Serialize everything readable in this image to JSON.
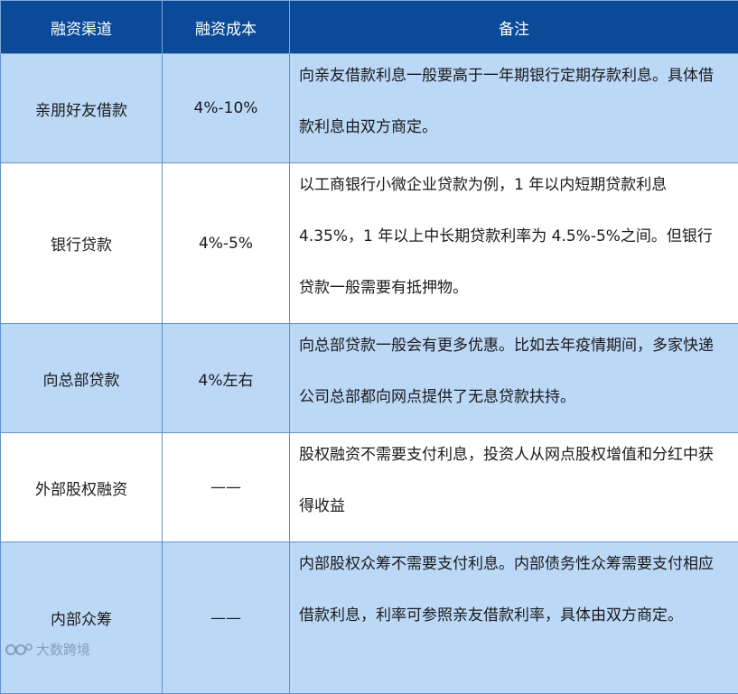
{
  "table": {
    "headers": [
      "融资渠道",
      "融资成本",
      "备注"
    ],
    "rows": [
      {
        "channel": "亲朋好友借款",
        "cost": "4%-10%",
        "note": "向亲友借款利息一般要高于一年期银行定期存款利息。具体借款利息由双方商定。"
      },
      {
        "channel": "银行贷款",
        "cost": "4%-5%",
        "note": "以工商银行小微企业贷款为例，1 年以内短期贷款利息 4.35%，1 年以上中长期贷款利率为 4.5%-5%之间。但银行贷款一般需要有抵押物。"
      },
      {
        "channel": "向总部贷款",
        "cost": "4%左右",
        "note": "向总部贷款一般会有更多优惠。比如去年疫情期间，多家快递公司总部都向网点提供了无息贷款扶持。"
      },
      {
        "channel": "外部股权融资",
        "cost": "——",
        "note": "股权融资不需要支付利息，投资人从网点股权增值和分红中获得收益"
      },
      {
        "channel": "内部众筹",
        "cost": "——",
        "note": "内部股权众筹不需要支付利息。内部债务性众筹需要支付相应借款利息，利率可参照亲友借款利率，具体由双方商定。"
      }
    ]
  },
  "watermark": {
    "text": "大数跨境",
    "icon": "logo-icon"
  }
}
